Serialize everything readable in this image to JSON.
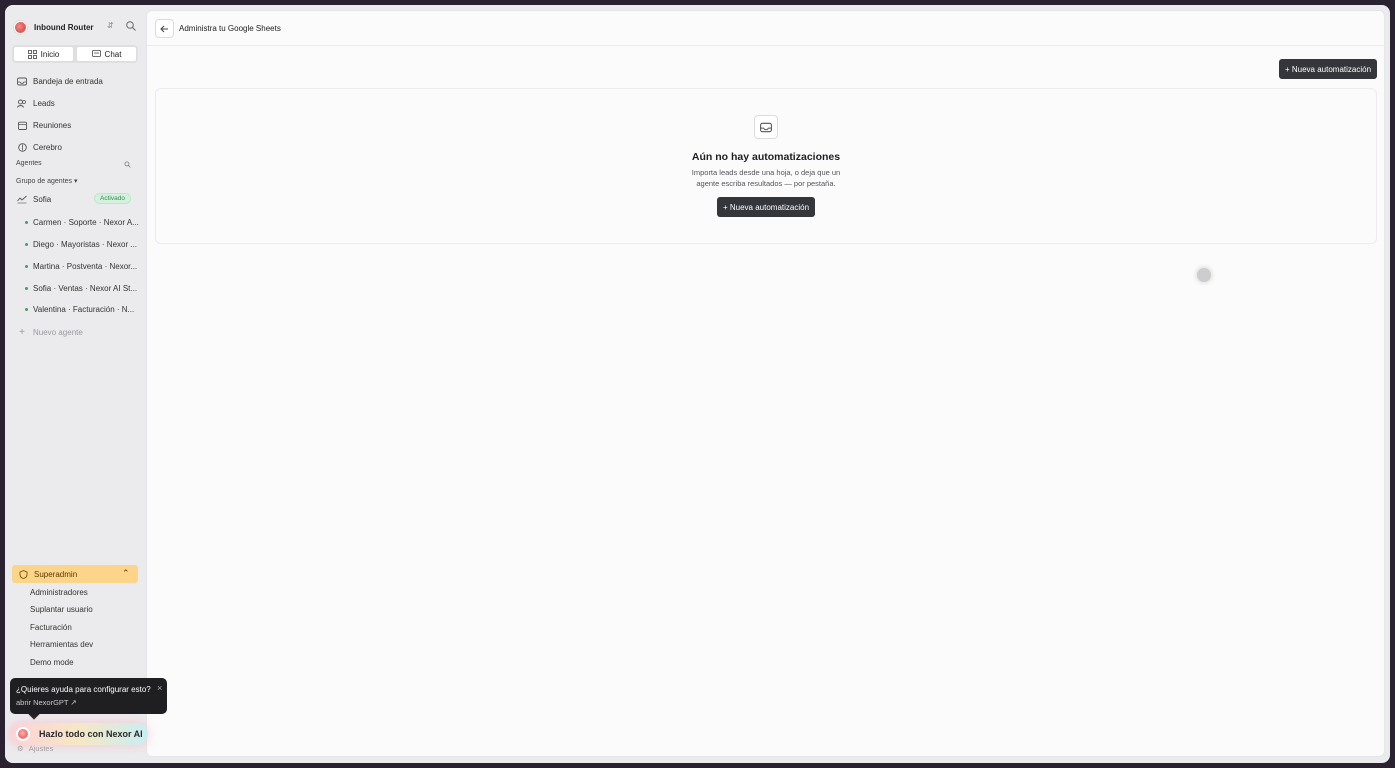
{
  "workspace": {
    "name": "Inbound Router"
  },
  "tabs": [
    {
      "label": "Inicio"
    },
    {
      "label": "Chat"
    }
  ],
  "nav": [
    {
      "label": "Bandeja de entrada"
    },
    {
      "label": "Leads"
    },
    {
      "label": "Reuniones"
    },
    {
      "label": "Cerebro"
    }
  ],
  "agents_section": {
    "label": "Agentes",
    "group_label": "Grupo de agentes ▾"
  },
  "group_agent": {
    "name": "Sofia",
    "badge": "Activado"
  },
  "agents": [
    {
      "label": "Carmen · Soporte · Nexor A..."
    },
    {
      "label": "Diego · Mayoristas · Nexor ..."
    },
    {
      "label": "Martina · Postventa · Nexor..."
    },
    {
      "label": "Sofia · Ventas · Nexor AI St..."
    },
    {
      "label": "Valentina · Facturación · N..."
    }
  ],
  "new_agent": "Nuevo agente",
  "superadmin": {
    "label": "Superadmin",
    "items": [
      {
        "label": "Administradores"
      },
      {
        "label": "Suplantar usuario"
      },
      {
        "label": "Facturación"
      },
      {
        "label": "Herramientas dev"
      },
      {
        "label": "Demo mode"
      }
    ]
  },
  "help_popup": {
    "question": "¿Quieres ayuda para configurar esto?",
    "link": "abrir NexorGPT ↗",
    "close": "×"
  },
  "nexor_button": {
    "label": "Hazlo todo con Nexor AI"
  },
  "settings": {
    "label": "Ajustes"
  },
  "main": {
    "title": "Administra tu Google Sheets",
    "new_button": "+ Nueva automatización",
    "empty": {
      "title": "Aún no hay automatizaciones",
      "description": "Importa leads desde una hoja, o deja que un agente escriba resultados — por pestaña.",
      "button": "+ Nueva automatización"
    }
  }
}
